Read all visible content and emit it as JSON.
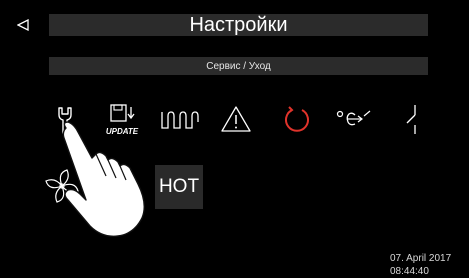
{
  "header": {
    "back_icon": "back-triangle-icon",
    "title": "Настройки"
  },
  "submenu": {
    "title": "Сервис / Уход"
  },
  "icons": [
    {
      "name": "wrench-icon"
    },
    {
      "name": "update-icon",
      "label": "UPDATE"
    },
    {
      "name": "heating-element-icon"
    },
    {
      "name": "warning-icon"
    },
    {
      "name": "reset-circle-icon"
    },
    {
      "name": "temperature-unit-icon"
    },
    {
      "name": "switch-icon"
    },
    {
      "name": "fan-icon"
    }
  ],
  "hot_button": {
    "label": "HOT"
  },
  "status": {
    "date": "07. April 2017",
    "time": "08:44:40"
  },
  "colors": {
    "background": "#000000",
    "bar": "#2b2b2b",
    "icon": "#ffffff",
    "reset_accent": "#e0332b"
  }
}
